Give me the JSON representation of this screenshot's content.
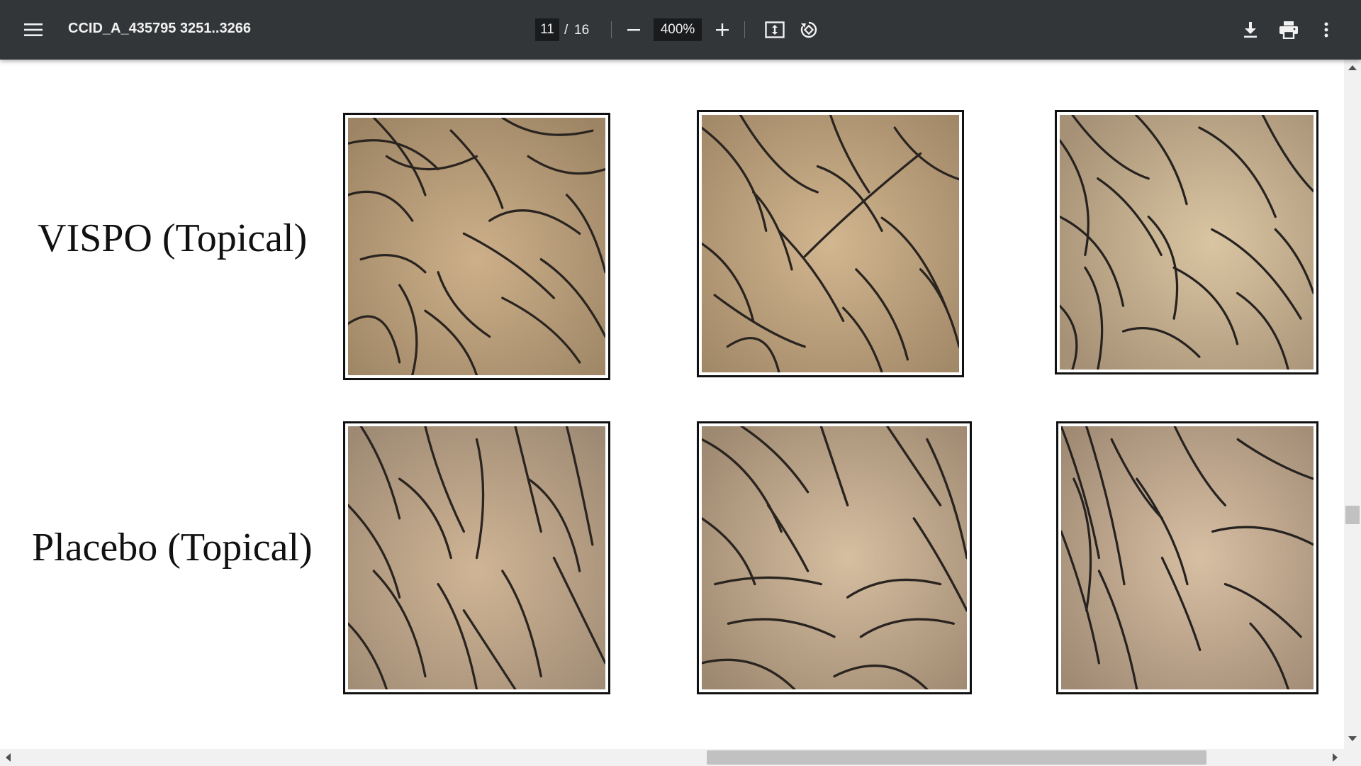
{
  "toolbar": {
    "document_title": "CCID_A_435795 3251..3266",
    "current_page": "11",
    "page_separator": "/",
    "total_pages": "16",
    "zoom_level": "400%",
    "icons": {
      "menu": "menu-icon",
      "zoom_out": "minus-icon",
      "zoom_in": "plus-icon",
      "fit_page": "fit-page-icon",
      "rotate": "rotate-counterclockwise-icon",
      "download": "download-icon",
      "print": "print-icon",
      "more": "more-vertical-icon"
    }
  },
  "document": {
    "rows": [
      {
        "label": "VISPO (Topical)"
      },
      {
        "label": "Placebo (Topical)"
      }
    ]
  },
  "colors": {
    "toolbar_bg": "#323639",
    "toolbar_text": "#f1f1f1",
    "page_bg": "#ffffff",
    "scrollbar_track": "#f1f1f1",
    "scrollbar_thumb": "#c1c1c1"
  }
}
